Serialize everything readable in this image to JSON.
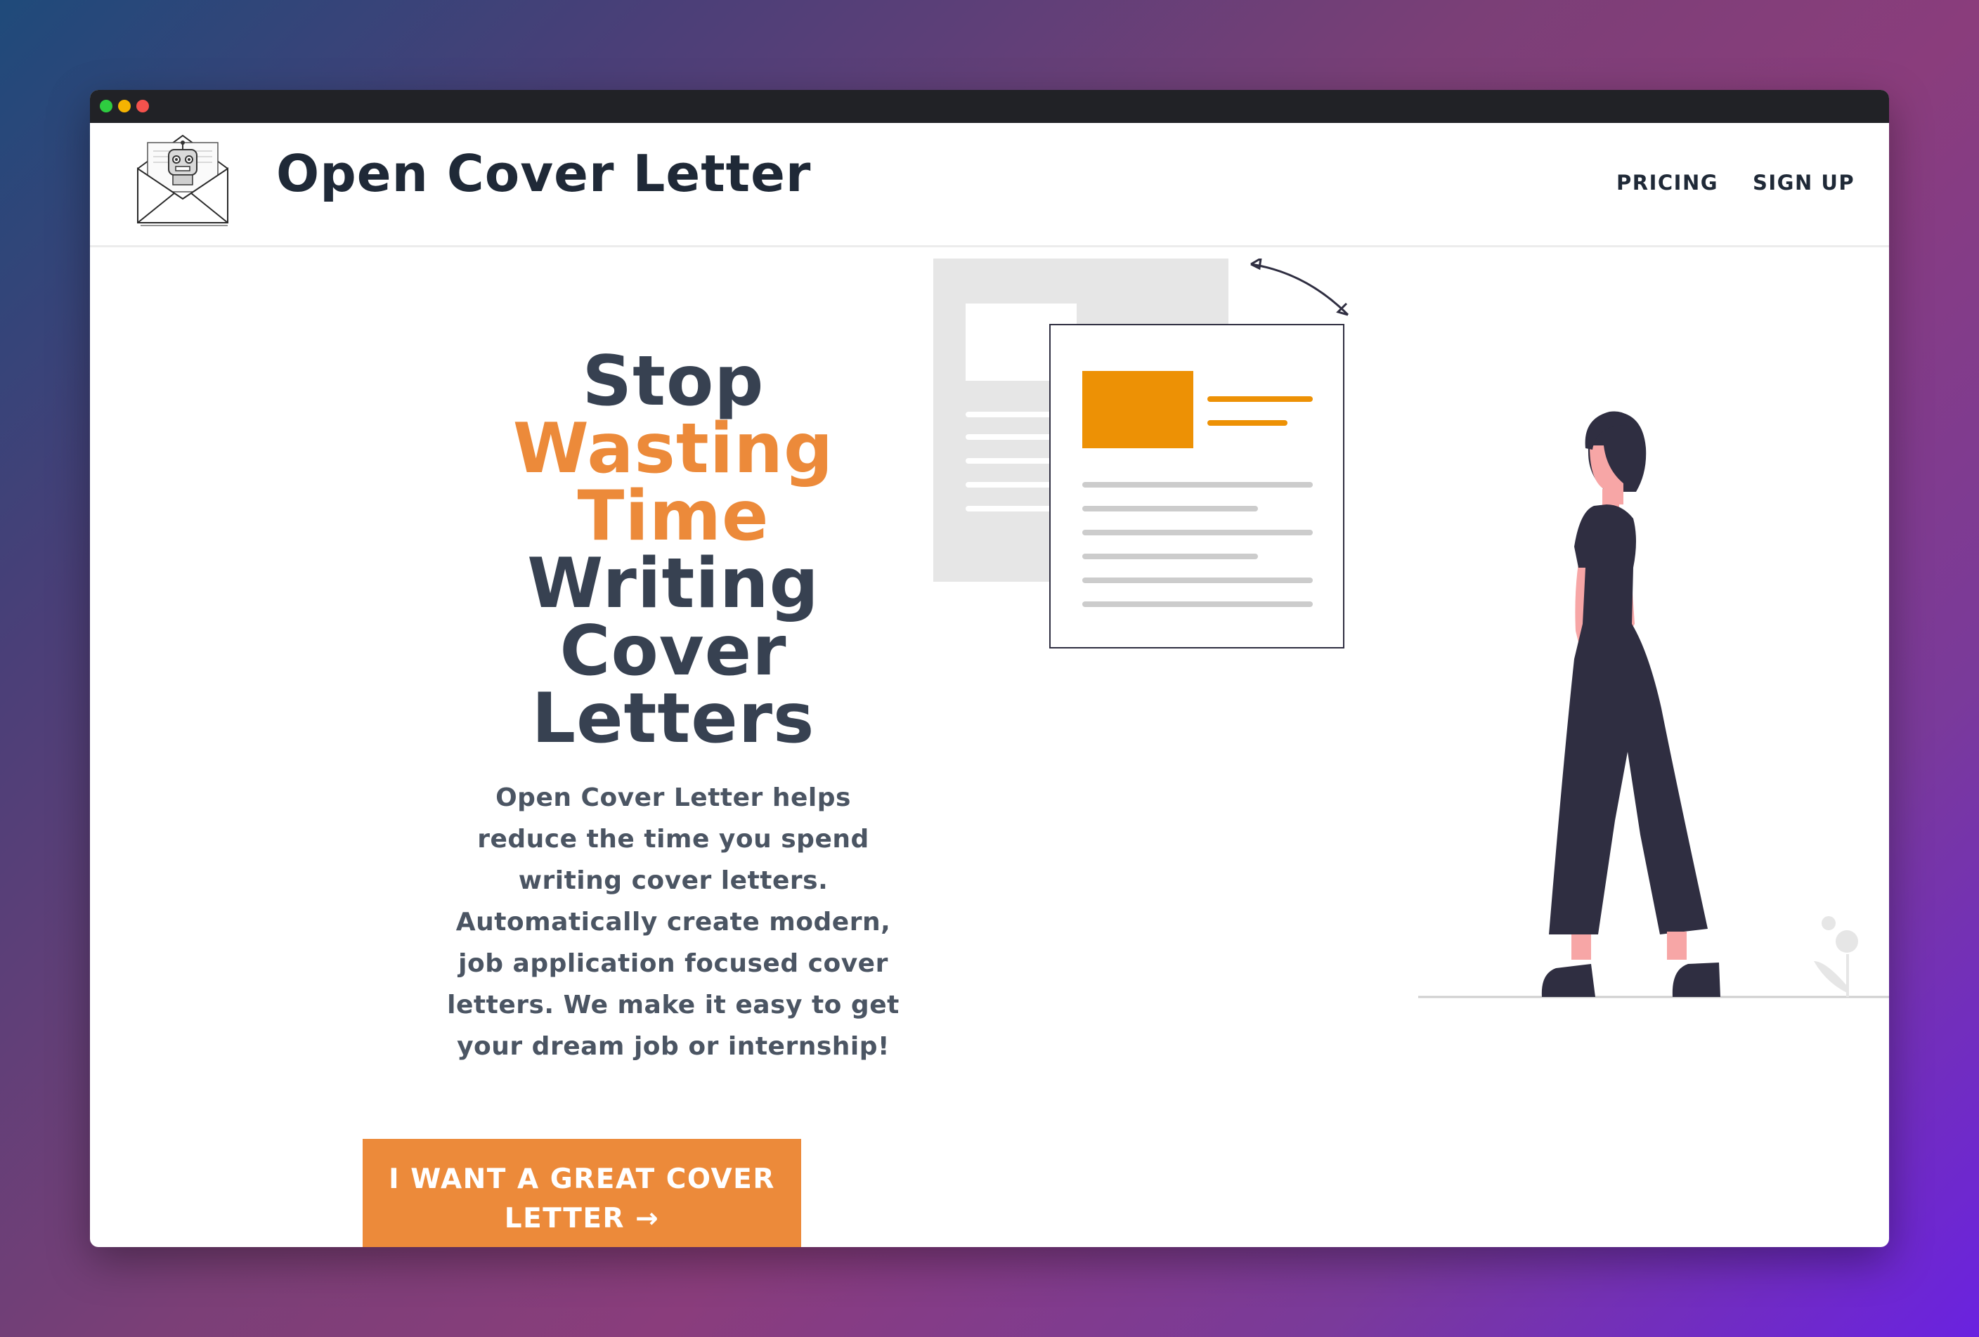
{
  "window": {
    "controls": [
      "close",
      "minimize",
      "maximize"
    ]
  },
  "nav": {
    "logo_icon": "envelope-robot-logo",
    "brand": "Open Cover Letter",
    "links": [
      {
        "label": "PRICING"
      },
      {
        "label": "SIGN UP"
      }
    ]
  },
  "hero": {
    "title_lines": [
      "Stop",
      "Wasting",
      "Time",
      "Writing",
      "Cover",
      "Letters"
    ],
    "description_lines": [
      "Open Cover Letter helps",
      "reduce the time you spend",
      "writing cover letters.",
      "Automatically create modern,",
      "job application focused cover",
      "letters. We make it easy to get",
      "your dream job or internship!"
    ],
    "cta_lines": [
      "I WANT A GREAT COVER",
      "LETTER →"
    ]
  },
  "colors": {
    "accent": "#ec8a3a",
    "heading": "#374151",
    "titlebar": "#212226",
    "illustration_orange": "#ed9105",
    "figure_dark": "#2f2e41",
    "skin": "#f7a6a6"
  }
}
